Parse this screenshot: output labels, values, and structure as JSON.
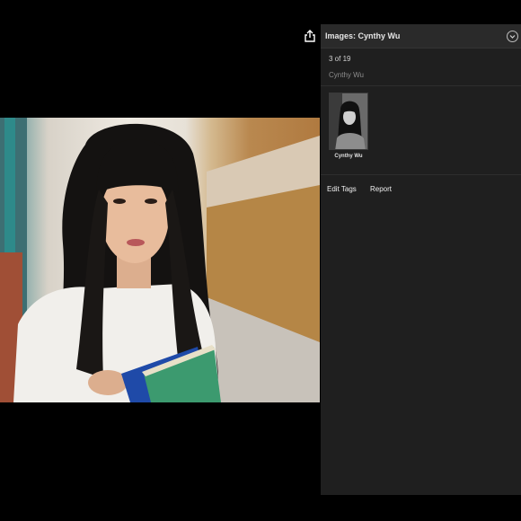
{
  "viewer": {
    "photo_alt": "Portrait of a woman with long black hair and bangs holding books"
  },
  "toolbar": {
    "share_icon": "share-icon"
  },
  "panel": {
    "title": "Images: Cynthy Wu",
    "collapse_icon": "chevron-down-circle-icon",
    "position": "3 of 19",
    "subtitle": "Cynthy Wu",
    "related": [
      {
        "caption": "Cynthy Wu"
      }
    ],
    "actions": {
      "edit_tags": "Edit Tags",
      "report": "Report"
    }
  },
  "colors": {
    "panel_bg": "#1f1f1f",
    "panel_header_bg": "#2a2a2a",
    "page_bg": "#000000"
  }
}
